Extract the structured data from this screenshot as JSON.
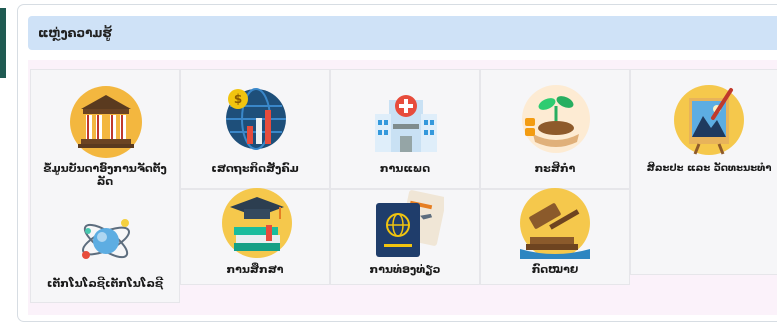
{
  "header": {
    "title": "ແຫຼ່ງຄວາມຮູ້"
  },
  "categories": [
    {
      "label": "ຂໍ້ມູນບັນດາອົງການຈັດຕັ້ງ ລັດ",
      "icon": "government-building-icon"
    },
    {
      "label": "ເສດຖະກິດສັງຄົມ",
      "icon": "economy-globe-icon"
    },
    {
      "label": "ການແພດ",
      "icon": "hospital-icon"
    },
    {
      "label": "ກະສິກຳ",
      "icon": "agriculture-seedling-icon"
    },
    {
      "label": "ສິລະປະ ແລະ ວັດທະນະທຳ",
      "icon": "art-painting-icon"
    },
    {
      "label": "ເຕັກໂນໂລຊີເຕັກໂນໂລຊີ",
      "icon": "technology-atom-icon"
    },
    {
      "label": "ການສຶກສາ",
      "icon": "education-cap-icon"
    },
    {
      "label": "ການທ່ອງທ່ຽວ",
      "icon": "tourism-passport-icon"
    },
    {
      "label": "ກົດໝາຍ",
      "icon": "law-gavel-icon"
    }
  ]
}
